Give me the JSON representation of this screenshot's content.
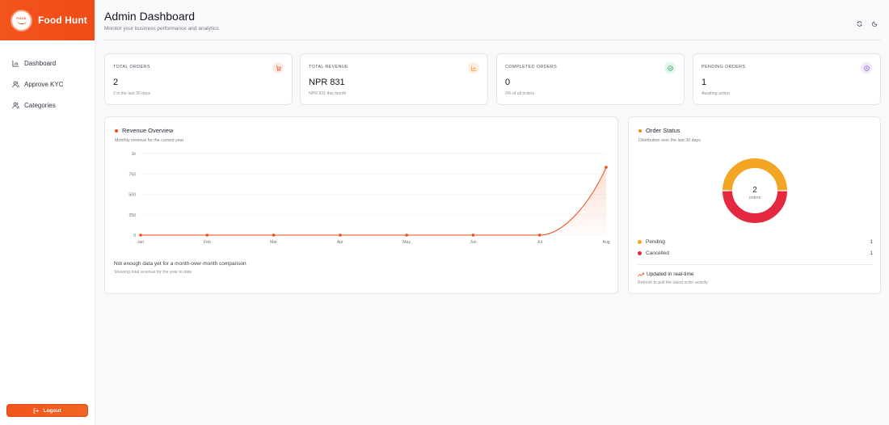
{
  "brand": {
    "name": "Food Hunt",
    "logo_text": "FOOD",
    "accent": "#ef4c17"
  },
  "sidebar": {
    "items": [
      {
        "label": "Dashboard",
        "icon": "bar-chart-icon"
      },
      {
        "label": "Approve KYC",
        "icon": "users-icon"
      },
      {
        "label": "Categories",
        "icon": "users-icon"
      }
    ],
    "logout_label": "Logout"
  },
  "header": {
    "title": "Admin Dashboard",
    "subtitle": "Monitor your business performance and analytics"
  },
  "stats": [
    {
      "label": "TOTAL ORDERS",
      "value": "2",
      "sub": "2 in the last 30 days",
      "icon": "cart-icon",
      "color": "#ef4c17",
      "bg": "#fdece6"
    },
    {
      "label": "TOTAL REVENUE",
      "value": "NPR 831",
      "sub": "NPR 831 this month",
      "icon": "bar-chart-icon",
      "color": "#f08a12",
      "bg": "#fdf0e0"
    },
    {
      "label": "COMPLETED ORDERS",
      "value": "0",
      "sub": "0% of all orders",
      "icon": "check-circle-icon",
      "color": "#1aa35a",
      "bg": "#e3f6ea"
    },
    {
      "label": "PENDING ORDERS",
      "value": "1",
      "sub": "Awaiting action",
      "icon": "clock-icon",
      "color": "#7c4ddb",
      "bg": "#efe8fb"
    }
  ],
  "revenue": {
    "title": "Revenue Overview",
    "subtitle": "Monthly revenue for the current year",
    "note_title": "Not enough data yet for a month-over-month comparison",
    "note_sub": "Showing total revenue for the year to date"
  },
  "order_status": {
    "title": "Order Status",
    "subtitle": "Distribution over the last 30 days",
    "center_value": "2",
    "center_label": "orders",
    "legend": [
      {
        "label": "Pending",
        "count": "1",
        "color": "#f2a623"
      },
      {
        "label": "Cancelled",
        "count": "1",
        "color": "#e3283f"
      }
    ],
    "realtime_title": "Updated in real-time",
    "realtime_sub": "Refresh to pull the latest order activity"
  },
  "chart_data": [
    {
      "type": "area",
      "categories": [
        "Jan",
        "Feb",
        "Mar",
        "Apr",
        "May",
        "Jun",
        "Jul",
        "Aug"
      ],
      "values": [
        0,
        0,
        0,
        0,
        0,
        0,
        0,
        831
      ],
      "y_ticks": [
        "0",
        "250",
        "500",
        "750",
        "1k"
      ],
      "ylim": [
        0,
        1000
      ],
      "grid": true,
      "color": "#ef4c17"
    },
    {
      "type": "pie",
      "categories": [
        "Pending",
        "Cancelled"
      ],
      "values": [
        1,
        1
      ],
      "colors": [
        "#f2a623",
        "#e3283f"
      ]
    }
  ]
}
